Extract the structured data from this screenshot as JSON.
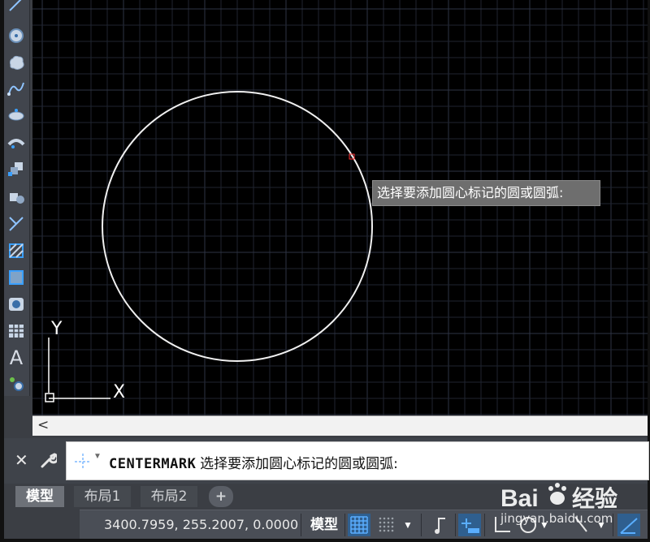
{
  "canvas": {
    "tooltip": "选择要添加圆心标记的圆或圆弧:",
    "ucs_y_label": "Y",
    "ucs_x_label": "X",
    "scroll_left": "<"
  },
  "command_line": {
    "close_icon": "close-icon",
    "command_name": "CENTERMARK",
    "prompt": "选择要添加圆心标记的圆或圆弧:"
  },
  "tabs": [
    {
      "label": "模型",
      "active": true
    },
    {
      "label": "布局1",
      "active": false
    },
    {
      "label": "布局2",
      "active": false
    },
    {
      "label": "+",
      "active": false
    }
  ],
  "status": {
    "coordinates": "3400.7959, 255.2007, 0.0000",
    "model_label": "模型"
  },
  "toolbar": {
    "items": [
      "polyline-icon",
      "circle-icon",
      "revcloud-icon",
      "spline-icon",
      "ellipse-icon",
      "ellipse-arc-icon",
      "insert-block-icon",
      "make-block-icon",
      "point-icon",
      "hatch-icon",
      "gradient-icon",
      "region-icon",
      "table-icon",
      "multiline-text-icon",
      "add-selected-icon"
    ],
    "text_tool_glyph": "A"
  },
  "watermark": {
    "brand": "Bai",
    "brand_after": "经验",
    "site": "jingyan.baidu.com"
  },
  "colors": {
    "canvas_bg": "#000000",
    "grid_minor": "#1f2430",
    "grid_major": "#2e3444",
    "accent_blue": "#3aa0ff"
  }
}
